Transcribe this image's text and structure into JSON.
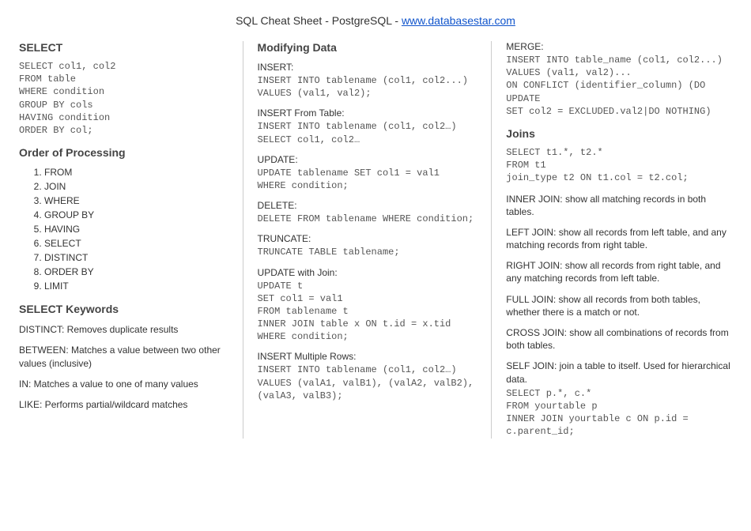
{
  "header": {
    "title": "SQL Cheat Sheet - PostgreSQL - ",
    "link_text": "www.databasestar.com"
  },
  "col1": {
    "select_heading": "SELECT",
    "select_sql": "SELECT col1, col2\nFROM table\nWHERE condition\nGROUP BY cols\nHAVING condition\nORDER BY col;",
    "order_heading": "Order of Processing",
    "order_items": [
      "FROM",
      "JOIN",
      "WHERE",
      "GROUP BY",
      "HAVING",
      "SELECT",
      "DISTINCT",
      "ORDER BY",
      "LIMIT"
    ],
    "keywords_heading": "SELECT Keywords",
    "kw_distinct": "DISTINCT: Removes duplicate results",
    "kw_between": "BETWEEN: Matches a value between two other values (inclusive)",
    "kw_in": "IN: Matches a value to one of many values",
    "kw_like": "LIKE: Performs partial/wildcard matches"
  },
  "col2": {
    "modify_heading": "Modifying Data",
    "insert_label": "INSERT:",
    "insert_sql": "INSERT INTO tablename (col1, col2...)\nVALUES (val1, val2);",
    "insert_from_label": "INSERT From Table:",
    "insert_from_sql": "INSERT INTO tablename (col1, col2…)\nSELECT col1, col2…",
    "update_label": "UPDATE:",
    "update_sql": "UPDATE tablename SET col1 = val1\nWHERE condition;",
    "delete_label": "DELETE:",
    "delete_sql": "DELETE FROM tablename WHERE condition;",
    "truncate_label": "TRUNCATE:",
    "truncate_sql": "TRUNCATE TABLE tablename;",
    "update_join_label": "UPDATE with Join:",
    "update_join_sql": "UPDATE t\nSET col1 = val1\nFROM tablename t\nINNER JOIN table x ON t.id = x.tid\nWHERE condition;",
    "insert_multi_label": "INSERT Multiple Rows:",
    "insert_multi_sql": "INSERT INTO tablename (col1, col2…)\nVALUES (valA1, valB1), (valA2, valB2),\n(valA3, valB3);"
  },
  "col3": {
    "merge_label": "MERGE:",
    "merge_sql": "INSERT INTO table_name (col1, col2...)\nVALUES (val1, val2)...\nON CONFLICT (identifier_column) (DO\nUPDATE\nSET col2 = EXCLUDED.val2|DO NOTHING)",
    "joins_heading": "Joins",
    "joins_sql": "SELECT t1.*, t2.*\nFROM t1\njoin_type t2 ON t1.col = t2.col;",
    "inner": "INNER JOIN: show all matching records in both tables.",
    "left": "LEFT JOIN: show all records from left table, and any matching records from right table.",
    "right": "RIGHT JOIN: show all records from right table, and any matching records from left table.",
    "full": "FULL JOIN: show all records from both tables, whether there is a match or not.",
    "cross": "CROSS JOIN: show all combinations of records from both tables.",
    "self": "SELF JOIN: join a table to itself. Used for hierarchical data.",
    "self_sql": "SELECT p.*, c.*\nFROM yourtable p\nINNER JOIN yourtable c ON p.id =\nc.parent_id;"
  }
}
